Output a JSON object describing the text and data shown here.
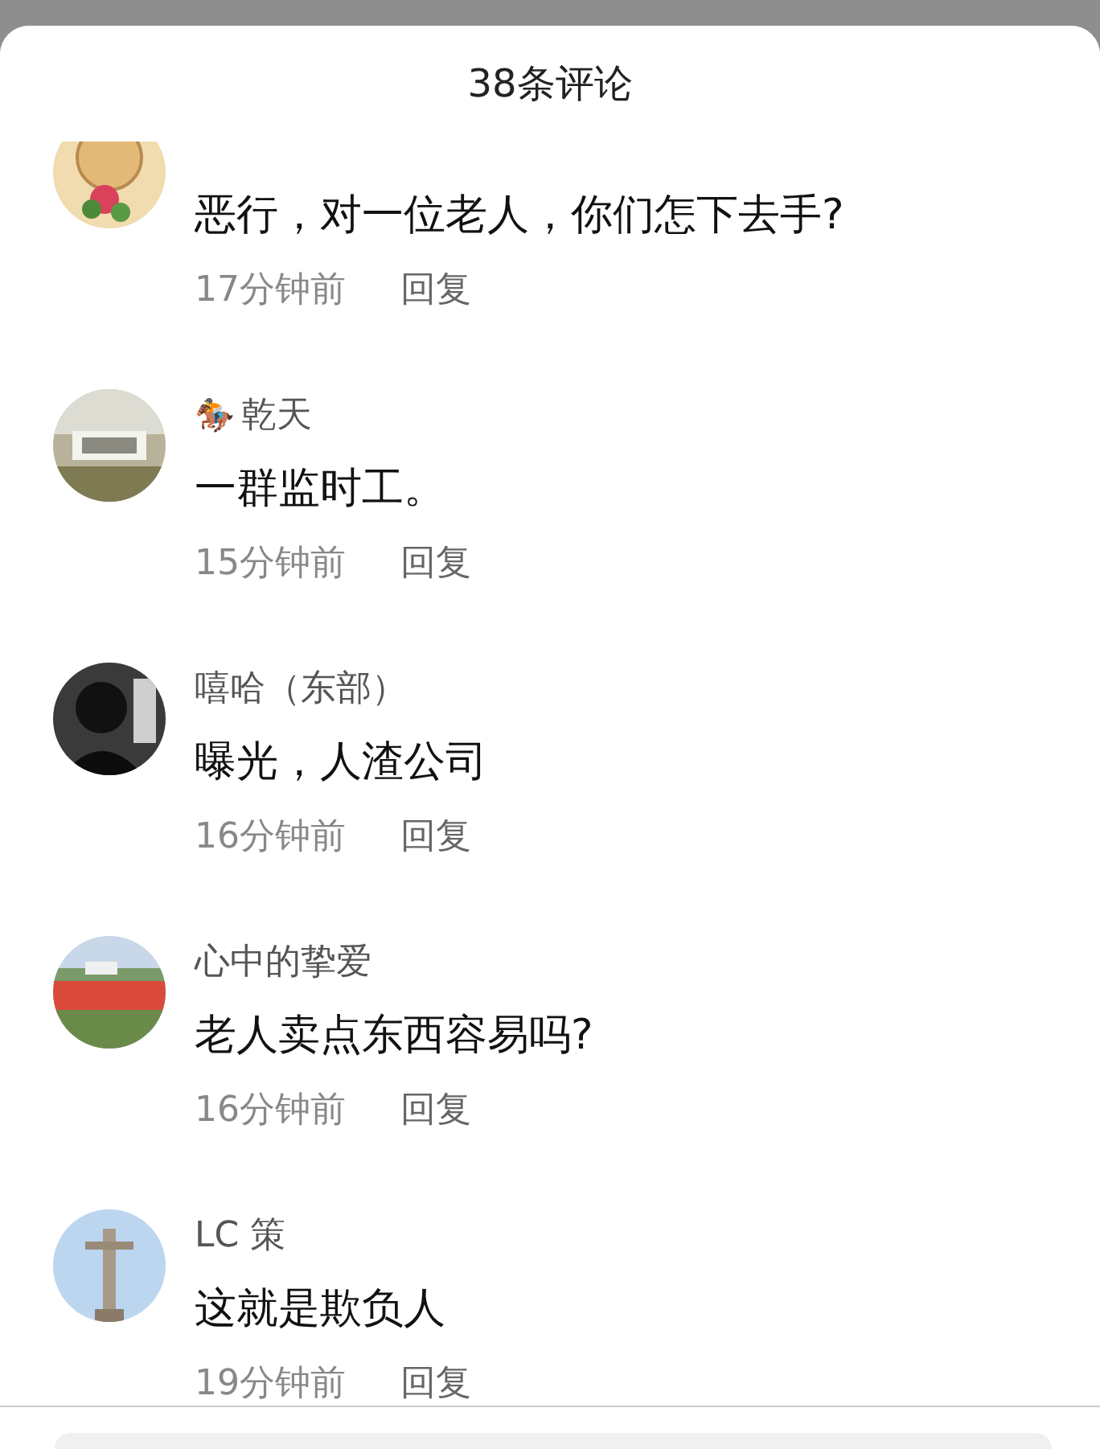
{
  "header": {
    "title": "38条评论"
  },
  "comments": [
    {
      "text": "恶行，对一位老人，你们怎下去手?",
      "time": "17分钟前",
      "reply": "回复"
    },
    {
      "badge": "🏇",
      "name": "乾天",
      "text": "一群监时工。",
      "time": "15分钟前",
      "reply": "回复"
    },
    {
      "name": "嘻哈（东部）",
      "text": "曝光，人渣公司",
      "time": "16分钟前",
      "reply": "回复"
    },
    {
      "name": "心中的挚爱",
      "text": "老人卖点东西容易吗?",
      "time": "16分钟前",
      "reply": "回复"
    },
    {
      "name": "LC 策",
      "text": "这就是欺负人",
      "time": "19分钟前",
      "reply": "回复"
    }
  ]
}
